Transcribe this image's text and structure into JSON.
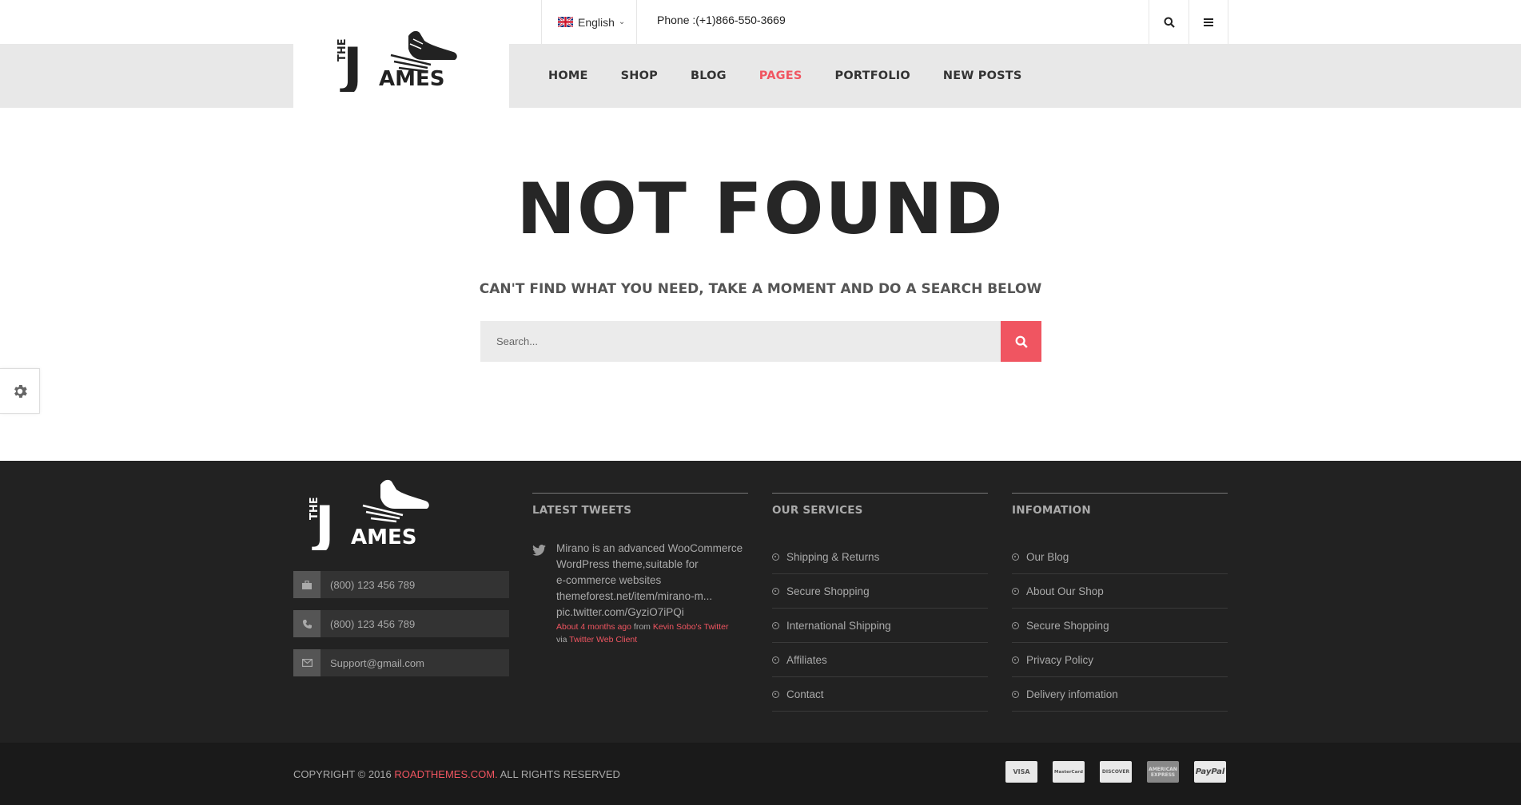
{
  "topbar": {
    "language": "English",
    "phone": "Phone :(+1)866-550-3669"
  },
  "nav": {
    "items": [
      {
        "label": "HOME"
      },
      {
        "label": "SHOP"
      },
      {
        "label": "BLOG"
      },
      {
        "label": "PAGES",
        "active": true
      },
      {
        "label": "PORTFOLIO"
      },
      {
        "label": "NEW POSTS"
      }
    ]
  },
  "logo": {
    "text_the": "THE",
    "text_j": "J",
    "text_ames": "AMES"
  },
  "main": {
    "title": "NOT FOUND",
    "subtitle": "CAN'T FIND WHAT YOU NEED, TAKE A MOMENT AND DO A SEARCH BELOW",
    "search_placeholder": "Search..."
  },
  "footer": {
    "contacts": [
      {
        "icon": "briefcase-icon",
        "text": "(800) 123 456 789"
      },
      {
        "icon": "phone-icon",
        "text": "(800) 123 456 789"
      },
      {
        "icon": "envelope-icon",
        "text": "Support@gmail.com"
      }
    ],
    "tweets": {
      "heading": "LATEST TWEETS",
      "text_line1": "Mirano is an advanced WooCommerce",
      "text_line2": "WordPress theme,suitable for",
      "text_line3": "e-commerce websites",
      "text_line4": "themeforest.net/item/mirano-m...",
      "text_line5": "pic.twitter.com/GyziO7iPQi",
      "time": "About 4 months ago",
      "from_word": "from",
      "author": "Kevin Sobo's Twitter",
      "via_word": "via",
      "client": "Twitter Web Client"
    },
    "services": {
      "heading": "OUR SERVICES",
      "items": [
        "Shipping & Returns",
        "Secure Shopping",
        "International Shipping",
        "Affiliates",
        "Contact"
      ]
    },
    "information": {
      "heading": "INFOMATION",
      "items": [
        "Our Blog",
        "About Our Shop",
        "Secure Shopping",
        "Privacy Policy",
        "Delivery infomation"
      ]
    },
    "copyright_prefix": "COPYRIGHT © 2016",
    "copyright_brand": "ROADTHEMES.COM.",
    "copyright_suffix": "ALL RIGHTS RESERVED",
    "payment_cards": [
      "VISA",
      "MasterCard",
      "DISCOVER",
      "AMERICAN EXPRESS",
      "PayPal"
    ]
  },
  "colors": {
    "accent": "#f05561",
    "footer_bg": "#222222",
    "nav_bg": "#e8e8e8"
  }
}
